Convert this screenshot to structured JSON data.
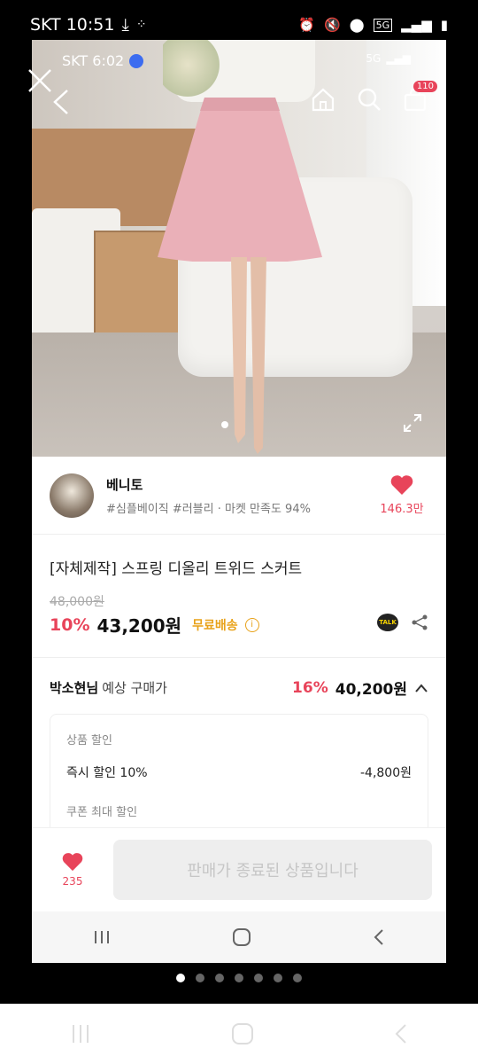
{
  "outer_status": {
    "carrier_time": "SKT 10:51",
    "network": "5G"
  },
  "inner_status": {
    "carrier_time": "SKT 6:02",
    "network": "5G"
  },
  "header": {
    "cart_count": "110"
  },
  "shop": {
    "name": "베니토",
    "tags": "#심플베이직 #러블리 · 마켓 만족도 94%",
    "like_count": "146.3만"
  },
  "product": {
    "title": "[자체제작] 스프링 디올리 트위드 스커트",
    "original_price": "48,000원",
    "discount": "10%",
    "price": "43,200원",
    "free_shipping": "무료배송",
    "talk_label": "TALK"
  },
  "expected": {
    "buyer": "박소현님",
    "label": "예상 구매가",
    "discount": "16%",
    "price": "40,200원"
  },
  "details": {
    "product_discount_label": "상품 할인",
    "instant_label": "즉시 할인 10%",
    "instant_value": "-4,800원",
    "coupon_label": "쿠폰 최대 할인"
  },
  "bottom": {
    "like_count": "235",
    "ended_button": "판매가 종료된 상품입니다"
  },
  "colors": {
    "accent": "#e8445a",
    "free_ship": "#e8a21a"
  },
  "gallery": {
    "pages": 7,
    "active": 1
  }
}
